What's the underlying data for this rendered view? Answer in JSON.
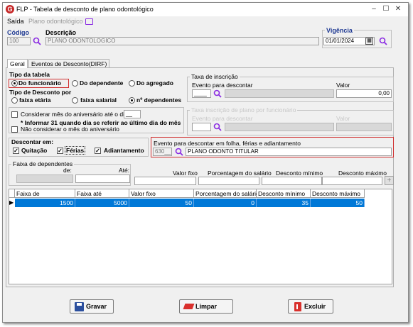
{
  "window": {
    "title": "FLP - Tabela de desconto de plano odontológico"
  },
  "menu": {
    "saida": "Saída",
    "plano": "Plano odontológico"
  },
  "header": {
    "codigo_label": "Código",
    "codigo_value": "100",
    "descricao_label": "Descrição",
    "descricao_value": "PLANO ODONTOLOGICO",
    "vigencia_label": "Vigência",
    "vigencia_value": "01/01/2024"
  },
  "tabs": [
    "Geral",
    "Eventos de Desconto(DIRF)"
  ],
  "tipo_tabela": {
    "label": "Tipo da tabela",
    "options": [
      "Do funcionário",
      "Do dependente",
      "Do agregado"
    ]
  },
  "tipo_desconto": {
    "label": "Tipo de Desconto por",
    "options": [
      "faixa etária",
      "faixa salarial",
      "nº dependentes"
    ]
  },
  "aniversario": {
    "considerar": "Considerar mês do aniversário até o dia",
    "informar": "* Informar 31 quando dia se referir ao último dia do mês",
    "nao_considerar": "Não considerar o mês do aniversário"
  },
  "descontar": {
    "label": "Descontar em:",
    "quitacao": "Quitação",
    "ferias": "Férias",
    "adiantamento": "Adiantamento"
  },
  "taxa": {
    "label": "Taxa de inscrição",
    "evento_label": "Evento para descontar",
    "valor_label": "Valor",
    "valor_value": "0,00"
  },
  "taxa2": {
    "label": "Taxa inscrição de plano por funcionário",
    "evento_label": "Evento para descontar",
    "valor_label": "Valor"
  },
  "evento_folha": {
    "label": "Evento para descontar em folha, férias e adiantamento",
    "code": "630__",
    "desc": "PLANO ODONTO TITULAR"
  },
  "faixa_dep": {
    "label": "Faixa de dependentes",
    "de": "de:",
    "ate": "Até:"
  },
  "cols_labels": {
    "valor_fixo": "Valor fixo",
    "porcentagem": "Porcentagem do salário",
    "desc_min": "Desconto mínimo",
    "desc_max": "Desconto máximo"
  },
  "table": {
    "headers": [
      "Faixa de",
      "Faixa até",
      "Valor fixo",
      "Porcentagem do salário",
      "Desconto mínimo",
      "Desconto máximo"
    ],
    "rows": [
      [
        "1500",
        "5000",
        "50",
        "0",
        "35",
        "50"
      ]
    ]
  },
  "buttons": {
    "gravar": "Gravar",
    "limpar": "Limpar",
    "excluir": "Excluir"
  },
  "colors": {
    "accent": "#0078d7",
    "label_blue": "#1f3a93",
    "highlight": "#d03030"
  }
}
